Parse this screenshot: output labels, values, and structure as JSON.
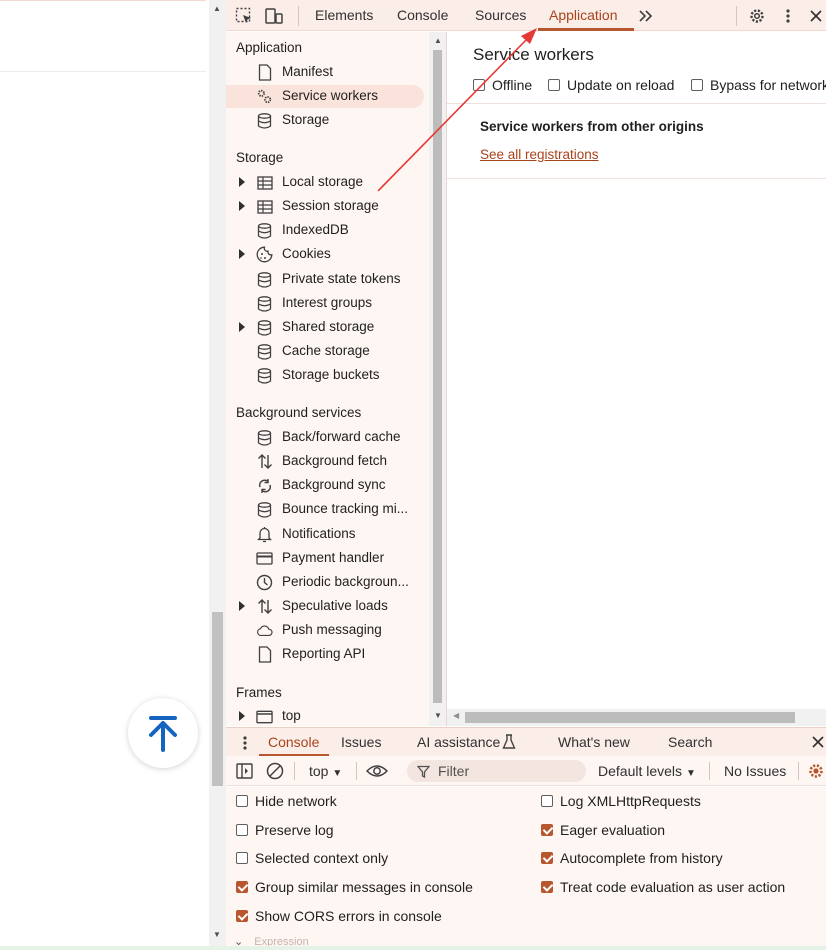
{
  "toolbar": {
    "tabs": [
      "Elements",
      "Console",
      "Sources",
      "Application"
    ],
    "active_tab": "Application",
    "more_tabs_icon": "chevron-double-right-icon"
  },
  "sidebar": {
    "sections": [
      {
        "title": "Application",
        "items": [
          {
            "label": "Manifest",
            "icon": "file-icon"
          },
          {
            "label": "Service workers",
            "icon": "gears-icon",
            "selected": true
          },
          {
            "label": "Storage",
            "icon": "database-icon"
          }
        ]
      },
      {
        "title": "Storage",
        "items": [
          {
            "label": "Local storage",
            "icon": "table-icon",
            "expandable": true
          },
          {
            "label": "Session storage",
            "icon": "table-icon",
            "expandable": true
          },
          {
            "label": "IndexedDB",
            "icon": "database-icon"
          },
          {
            "label": "Cookies",
            "icon": "cookie-icon",
            "expandable": true
          },
          {
            "label": "Private state tokens",
            "icon": "database-icon"
          },
          {
            "label": "Interest groups",
            "icon": "database-icon"
          },
          {
            "label": "Shared storage",
            "icon": "database-icon",
            "expandable": true
          },
          {
            "label": "Cache storage",
            "icon": "database-icon"
          },
          {
            "label": "Storage buckets",
            "icon": "database-icon"
          }
        ]
      },
      {
        "title": "Background services",
        "items": [
          {
            "label": "Back/forward cache",
            "icon": "database-icon"
          },
          {
            "label": "Background fetch",
            "icon": "up-down-arrows-icon"
          },
          {
            "label": "Background sync",
            "icon": "sync-icon"
          },
          {
            "label": "Bounce tracking mi...",
            "icon": "database-icon"
          },
          {
            "label": "Notifications",
            "icon": "bell-icon"
          },
          {
            "label": "Payment handler",
            "icon": "credit-card-icon"
          },
          {
            "label": "Periodic backgroun...",
            "icon": "clock-icon"
          },
          {
            "label": "Speculative loads",
            "icon": "up-down-arrows-icon",
            "expandable": true
          },
          {
            "label": "Push messaging",
            "icon": "cloud-icon"
          },
          {
            "label": "Reporting API",
            "icon": "file-icon"
          }
        ]
      },
      {
        "title": "Frames",
        "items": [
          {
            "label": "top",
            "icon": "frame-icon",
            "expandable": true
          }
        ]
      }
    ]
  },
  "main": {
    "title": "Service workers",
    "options": [
      {
        "label": "Offline",
        "checked": false
      },
      {
        "label": "Update on reload",
        "checked": false
      },
      {
        "label": "Bypass for network",
        "checked": false
      }
    ],
    "origins_heading": "Service workers from other origins",
    "see_all_link": "See all registrations"
  },
  "drawer": {
    "tabs": [
      "Console",
      "Issues",
      "AI assistance",
      "What's new",
      "Search"
    ],
    "active_tab": "Console",
    "context": "top",
    "filter_placeholder": "Filter",
    "levels": "Default levels",
    "issues": "No Issues"
  },
  "console_settings": {
    "left": [
      {
        "label": "Hide network",
        "checked": false
      },
      {
        "label": "Preserve log",
        "checked": false
      },
      {
        "label": "Selected context only",
        "checked": false
      },
      {
        "label": "Group similar messages in console",
        "checked": true
      },
      {
        "label": "Show CORS errors in console",
        "checked": true
      }
    ],
    "right": [
      {
        "label": "Log XMLHttpRequests",
        "checked": false
      },
      {
        "label": "Eager evaluation",
        "checked": true
      },
      {
        "label": "Autocomplete from history",
        "checked": true
      },
      {
        "label": "Treat code evaluation as user action",
        "checked": true
      }
    ]
  },
  "partial_text": "Expression",
  "colors": {
    "accent": "#b8562e",
    "active_text": "#a9431b",
    "panel_bg": "#fdf6f3",
    "toolbar_bg": "#fbeee8",
    "annotation_arrow": "#e53935",
    "scroll_top_icon": "#1565c0"
  }
}
